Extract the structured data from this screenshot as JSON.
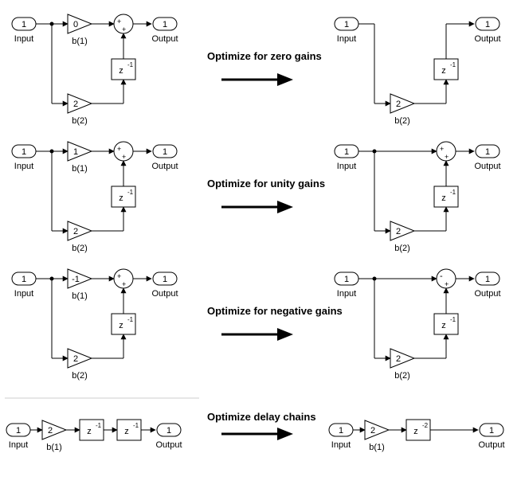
{
  "labels": {
    "input": "Input",
    "output": "Output",
    "port1": "1",
    "b1": "b(1)",
    "b2": "b(2)",
    "gain0": "0",
    "gain1": "1",
    "gain2": "2",
    "gainNeg1": "-1",
    "z1": "z",
    "z1_exp": "-1",
    "z2_exp": "-2",
    "plus": "+",
    "minus": "-"
  },
  "captions": {
    "zero": "Optimize for zero gains",
    "unity": "Optimize for unity gains",
    "negative": "Optimize for negative gains",
    "delay": "Optimize delay chains"
  }
}
